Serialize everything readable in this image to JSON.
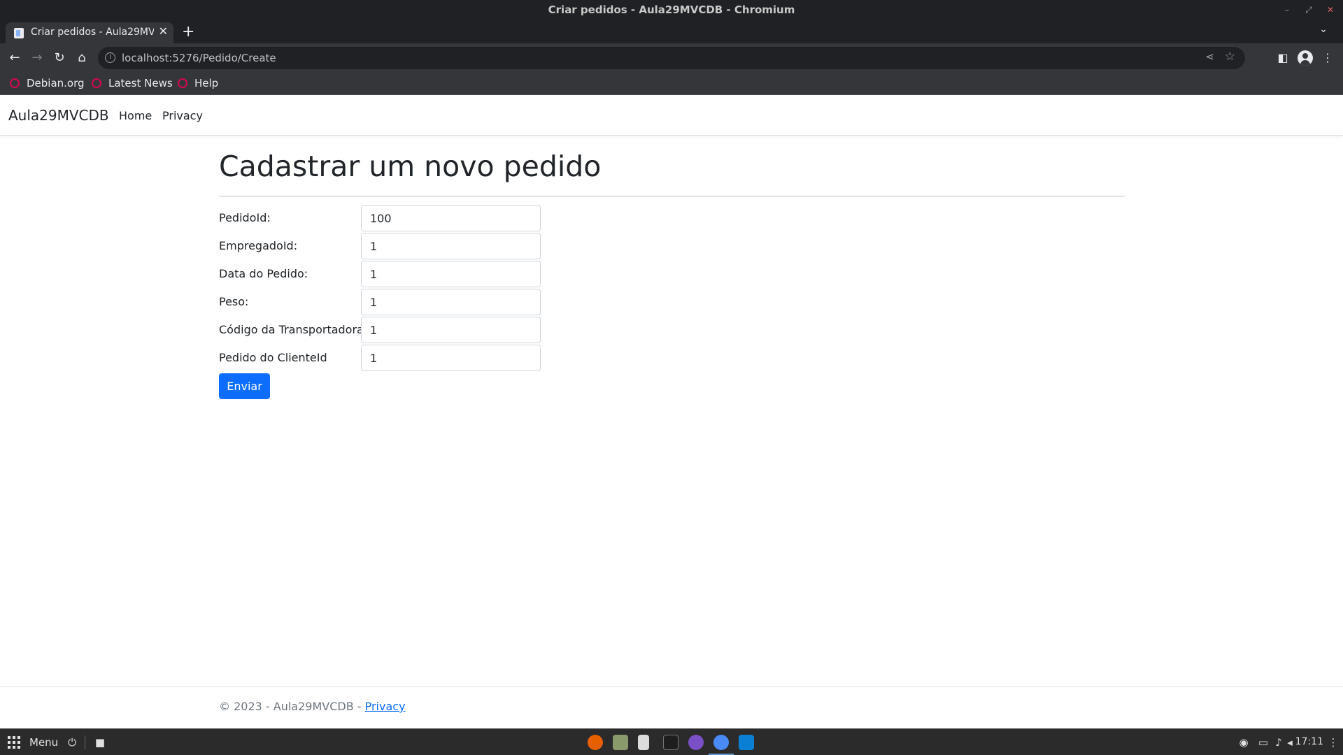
{
  "window": {
    "title": "Criar pedidos - Aula29MVCDB - Chromium",
    "controls": {
      "minimize": "–",
      "maximize": "⤢",
      "close": "✕"
    }
  },
  "tab": {
    "title": "Criar pedidos - Aula29MVCDB",
    "close": "✕",
    "new_tab": "+",
    "tab_list": "⌄"
  },
  "toolbar": {
    "back": "←",
    "forward": "→",
    "reload": "↻",
    "home": "⌂",
    "url": "localhost:5276/Pedido/Create",
    "info": "i",
    "share": "⋖",
    "bookmark": "☆",
    "sidepanel": "◧",
    "menu": "⋮"
  },
  "bookmarks": [
    {
      "label": "Debian.org"
    },
    {
      "label": "Latest News"
    },
    {
      "label": "Help"
    }
  ],
  "navbar": {
    "brand": "Aula29MVCDB",
    "links": [
      "Home",
      "Privacy"
    ]
  },
  "form": {
    "heading": "Cadastrar um novo pedido",
    "fields": [
      {
        "label": "PedidoId:",
        "value": "100"
      },
      {
        "label": "EmpregadoId:",
        "value": "1"
      },
      {
        "label": "Data do Pedido:",
        "value": "1"
      },
      {
        "label": "Peso:",
        "value": "1"
      },
      {
        "label": "Código da Transportadora:",
        "value": "1"
      },
      {
        "label": "Pedido do ClienteId",
        "value": "1"
      }
    ],
    "submit_label": "Enviar"
  },
  "footer": {
    "text": "© 2023 - Aula29MVCDB - ",
    "link": "Privacy"
  },
  "taskbar": {
    "menu_label": "Menu",
    "power": "⏻",
    "files": "■",
    "clock": "17:11"
  },
  "colors": {
    "primary": "#0d6efd",
    "chrome_dark": "#202124",
    "chrome_toolbar": "#35363a",
    "debian_red": "#d70751"
  }
}
